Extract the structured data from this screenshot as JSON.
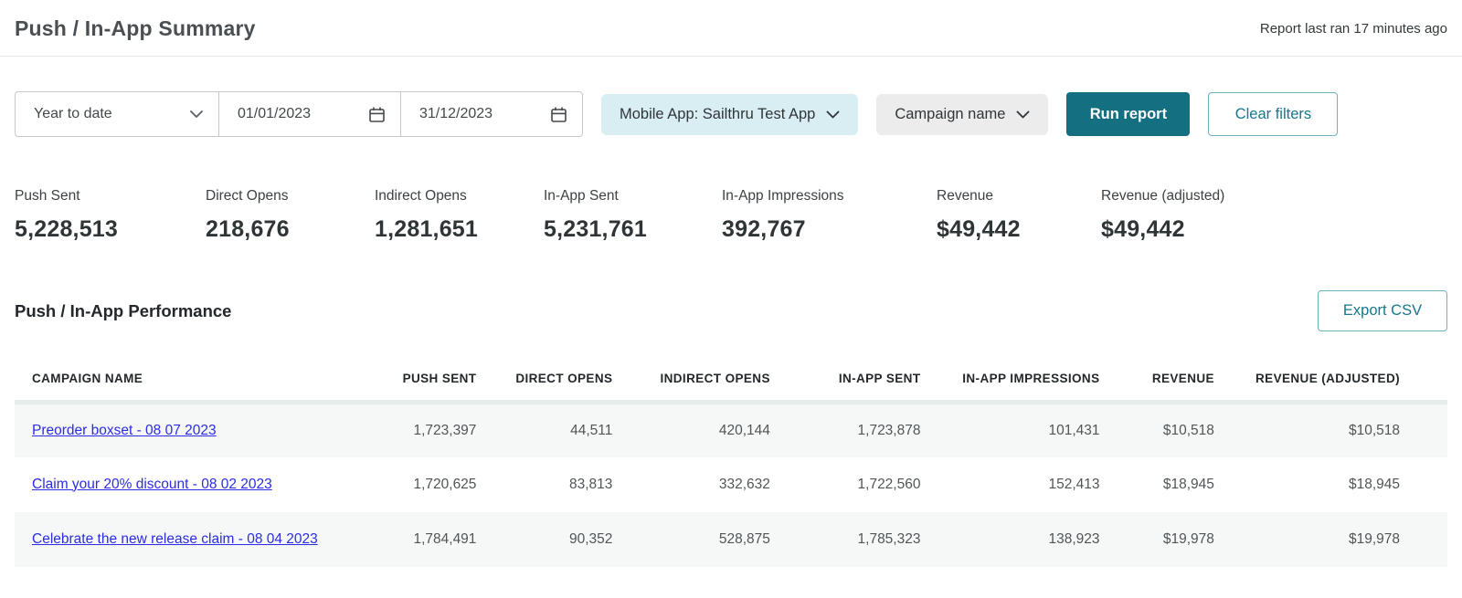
{
  "header": {
    "title": "Push / In-App Summary",
    "report_status": "Report last ran 17 minutes ago"
  },
  "filters": {
    "date_preset": "Year to date",
    "start_date": "01/01/2023",
    "end_date": "31/12/2023",
    "app_filter": "Mobile App: Sailthru Test App",
    "campaign_filter": "Campaign name",
    "run_report_label": "Run report",
    "clear_filters_label": "Clear filters"
  },
  "stats": [
    {
      "label": "Push Sent",
      "value": "5,228,513"
    },
    {
      "label": "Direct Opens",
      "value": "218,676"
    },
    {
      "label": "Indirect Opens",
      "value": "1,281,651"
    },
    {
      "label": "In-App Sent",
      "value": "5,231,761"
    },
    {
      "label": "In-App Impressions",
      "value": "392,767"
    },
    {
      "label": "Revenue",
      "value": "$49,442"
    },
    {
      "label": "Revenue (adjusted)",
      "value": "$49,442"
    }
  ],
  "performance": {
    "title": "Push / In-App Performance",
    "export_label": "Export CSV"
  },
  "table": {
    "columns": [
      "CAMPAIGN NAME",
      "PUSH SENT",
      "DIRECT OPENS",
      "INDIRECT OPENS",
      "IN-APP SENT",
      "IN-APP IMPRESSIONS",
      "REVENUE",
      "REVENUE (ADJUSTED)"
    ],
    "rows": [
      [
        "Preorder boxset - 08 07 2023",
        "1,723,397",
        "44,511",
        "420,144",
        "1,723,878",
        "101,431",
        "$10,518",
        "$10,518"
      ],
      [
        "Claim your 20% discount - 08 02 2023",
        "1,720,625",
        "83,813",
        "332,632",
        "1,722,560",
        "152,413",
        "$18,945",
        "$18,945"
      ],
      [
        "Celebrate the new release claim - 08 04 2023",
        "1,784,491",
        "90,352",
        "528,875",
        "1,785,323",
        "138,923",
        "$19,978",
        "$19,978"
      ]
    ]
  },
  "colors": {
    "accent_teal": "#146f80",
    "outline_teal": "#17768a",
    "link_blue": "#2b2ce4",
    "app_pill_bg": "#d9eef3",
    "campaign_pill_bg": "#ececec",
    "row_stripe": "#f6f8f8"
  }
}
